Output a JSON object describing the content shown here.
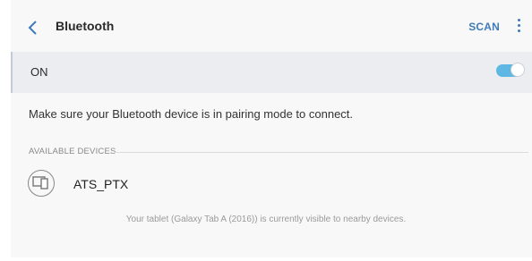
{
  "header": {
    "back_icon": "chevron-left-icon",
    "title": "Bluetooth",
    "scan_label": "SCAN",
    "more_icon": "more-vertical-icon",
    "accent_color": "#3e7bb8"
  },
  "toggle_row": {
    "label": "ON",
    "state": "on",
    "toggle_color": "#5fb8e3"
  },
  "info": {
    "text": "Make sure your Bluetooth device is in pairing mode to connect."
  },
  "available_devices": {
    "header": "AVAILABLE DEVICES",
    "items": [
      {
        "name": "ATS_PTX",
        "icon": "multiple-devices-icon"
      }
    ]
  },
  "footer": {
    "visibility_text": "Your tablet (Galaxy Tab A (2016)) is currently visible to nearby devices."
  }
}
